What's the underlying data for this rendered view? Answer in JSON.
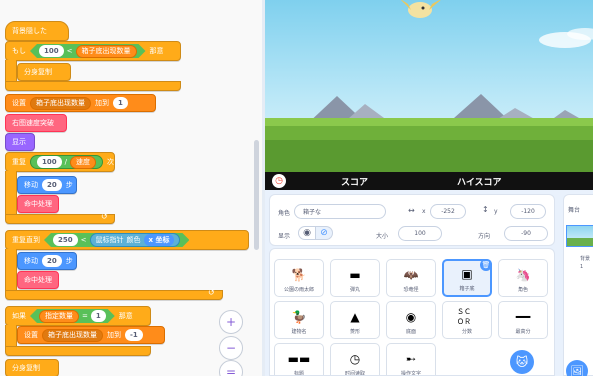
{
  "code": {
    "hat_label": "背景隠した",
    "if1": {
      "keyword": "もし",
      "operand": "100",
      "op": "<",
      "var": "箱子底出现数量",
      "suffix": "那意"
    },
    "send_label": "分身复制",
    "set_block": {
      "label": "设置",
      "var": "箱子底出现数量",
      "mid": "加到",
      "value": "1"
    },
    "pink_label": "右图速度突破",
    "show_label": "显示",
    "repeat1": {
      "keyword": "重复",
      "value": "100",
      "op": "/",
      "var": "速度",
      "suffix": "次"
    },
    "move1": {
      "label": "移动",
      "value": "20",
      "suffix": "步"
    },
    "brick_label": "命中处理",
    "repeat_until": {
      "keyword": "重复直到",
      "value": "250",
      "op": "<",
      "sensor": "鼠标指针",
      "field": "颜色",
      "var": "x 坐标"
    },
    "move2": {
      "label": "移动",
      "value": "20",
      "suffix": "步"
    },
    "brick2_label": "命中处理",
    "if2": {
      "keyword": "如果",
      "var": "指定数量",
      "op": "=",
      "value": "1",
      "suffix": "那意"
    },
    "set2": {
      "label": "设置",
      "var": "箱子底出现数量",
      "mid": "加到",
      "value": "-1"
    },
    "send2_label": "分身复制"
  },
  "zoom": {
    "in": "+",
    "out": "−",
    "reset": "="
  },
  "score_bar": {
    "score": "スコア",
    "high_score": "ハイスコア"
  },
  "sprite_info": {
    "name_label": "角色",
    "name_value": "箱子な",
    "x_label": "x",
    "x_value": "-252",
    "y_label": "y",
    "y_value": "-120",
    "show_label": "显示",
    "size_label": "大小",
    "size_value": "100",
    "dir_label": "方向",
    "dir_value": "-90"
  },
  "sprites": [
    {
      "name": "公園の雨太郎",
      "icon": "🐕"
    },
    {
      "name": "弾丸",
      "icon": "▬"
    },
    {
      "name": "恐竜怪",
      "icon": "🦇"
    },
    {
      "name": "箱子底",
      "icon": "▣"
    },
    {
      "name": "角色",
      "icon": "🦄"
    },
    {
      "name": "建物名",
      "icon": "🦆"
    },
    {
      "name": "菱形",
      "icon": "▲"
    },
    {
      "name": "底面",
      "icon": "◉"
    },
    {
      "name": "分数",
      "icon": "ＳＣＯＲ"
    },
    {
      "name": "最高分",
      "icon": "━━"
    },
    {
      "name": "标题",
      "icon": "▬▬"
    },
    {
      "name": "时间读取",
      "icon": "◷"
    },
    {
      "name": "操作文字",
      "icon": "➸"
    }
  ],
  "stage_target": {
    "label": "舞台",
    "count_label": "背景",
    "count": "1"
  },
  "buttons": {
    "add_sprite": "🐱",
    "add_backdrop": "🖼"
  }
}
